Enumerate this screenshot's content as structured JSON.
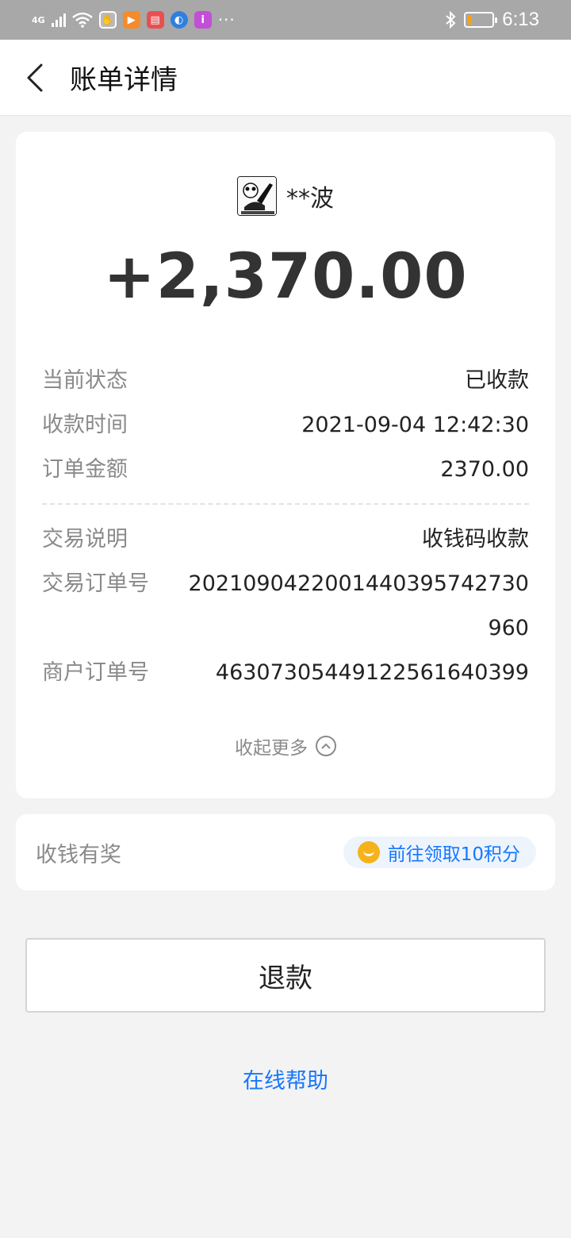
{
  "status_bar": {
    "network": "4G",
    "time": "6:13",
    "app_icons": [
      {
        "name": "hand-app-icon",
        "color": "#e9a7a7"
      },
      {
        "name": "video-app-icon",
        "color": "#f58b2a"
      },
      {
        "name": "reader-app-icon",
        "color": "#e85050"
      },
      {
        "name": "browser-app-icon",
        "color": "#2f7fe0"
      },
      {
        "name": "purple-app-icon",
        "color": "#c24fd6"
      }
    ],
    "more": "···"
  },
  "header": {
    "title": "账单详情"
  },
  "detail": {
    "payer_name": "**波",
    "amount": "+2,370.00",
    "rows_top": [
      {
        "label": "当前状态",
        "value": "已收款"
      },
      {
        "label": "收款时间",
        "value": "2021-09-04 12:42:30"
      },
      {
        "label": "订单金额",
        "value": "2370.00"
      }
    ],
    "rows_bottom": [
      {
        "label": "交易说明",
        "value": "收钱码收款"
      },
      {
        "label": "交易订单号",
        "value": "20210904220014403957427309​60"
      },
      {
        "label": "商户订单号",
        "value": "46307305449122561640399"
      }
    ],
    "collapse_label": "收起更多"
  },
  "reward": {
    "label": "收钱有奖",
    "action": "前往领取10积分"
  },
  "refund_label": "退款",
  "help_label": "在线帮助",
  "colors": {
    "accent": "#1677ff",
    "status_bar": "#a8a8a8",
    "coin": "#f6b21a",
    "background": "#f3f3f3"
  }
}
